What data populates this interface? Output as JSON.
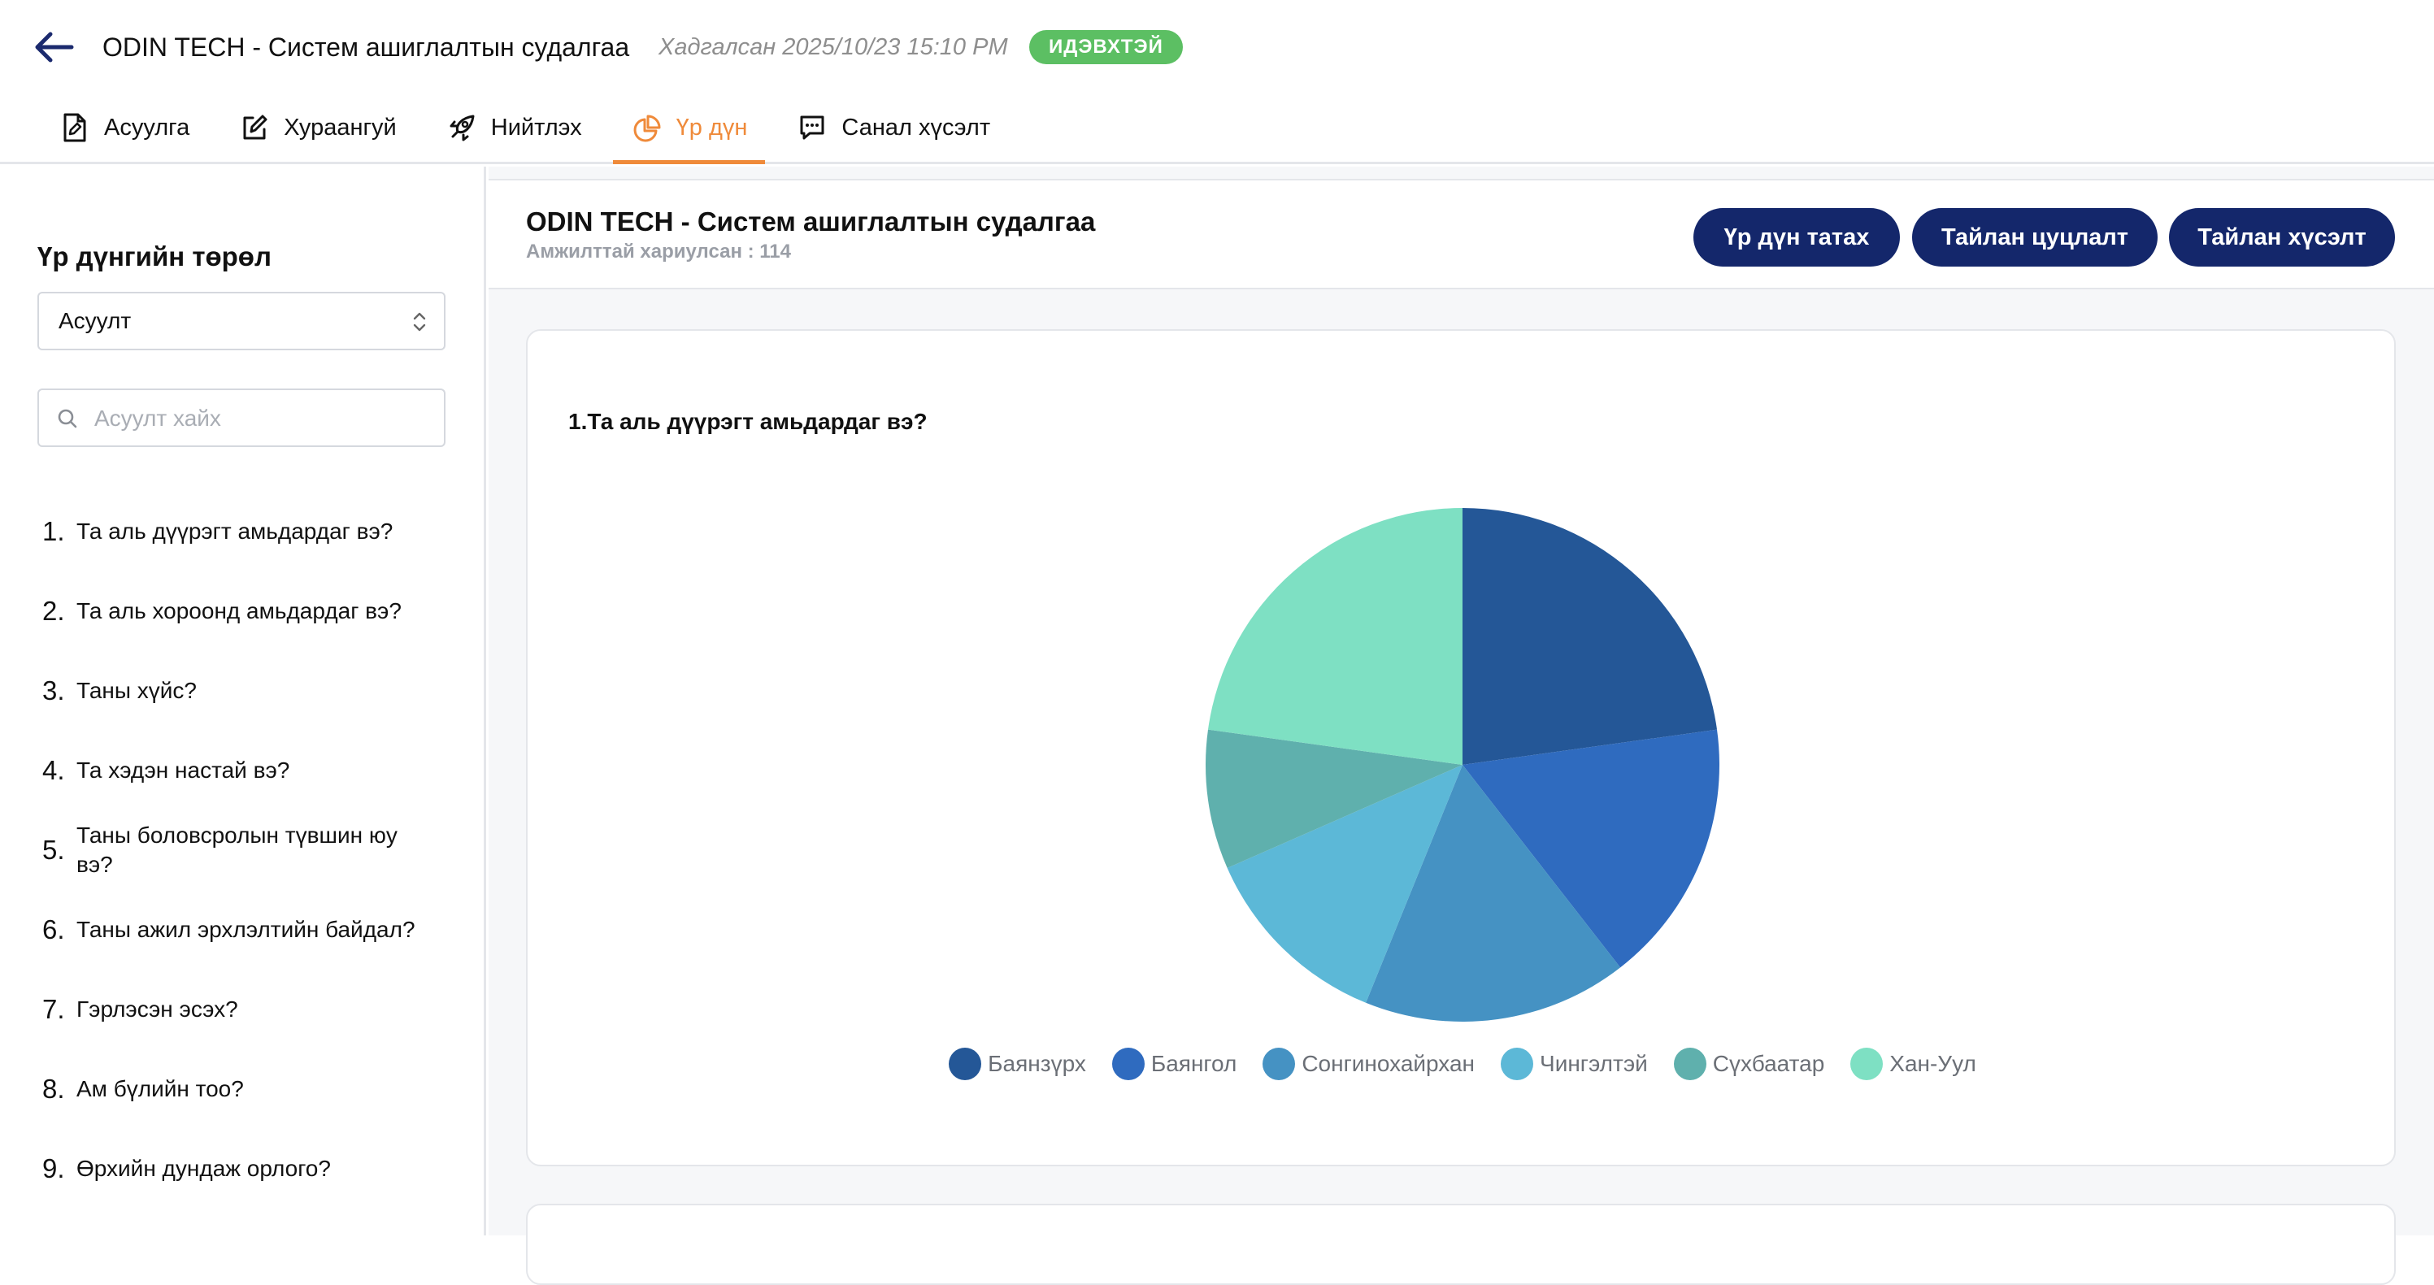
{
  "header": {
    "title": "ODIN TECH - Систем ашиглалтын судалгаа",
    "saved": "Хадгалсан 2025/10/23 15:10 PM",
    "status": "ИДЭВХТЭЙ"
  },
  "tabs": [
    {
      "label": "Асуулга",
      "icon": "document-edit-icon"
    },
    {
      "label": "Хураангуй",
      "icon": "pencil-square-icon"
    },
    {
      "label": "Нийтлэх",
      "icon": "rocket-icon"
    },
    {
      "label": "Үр дүн",
      "icon": "pie-chart-icon",
      "active": true
    },
    {
      "label": "Санал хүсэлт",
      "icon": "chat-icon"
    }
  ],
  "sidebar": {
    "heading": "Үр дүнгийн төрөл",
    "select_value": "Асуулт",
    "search_placeholder": "Асуулт хайх",
    "questions": [
      {
        "num": "1.",
        "text": "Та аль дүүрэгт амьдардаг вэ?"
      },
      {
        "num": "2.",
        "text": "Та аль хороонд амьдардаг вэ?"
      },
      {
        "num": "3.",
        "text": "Таны хүйс?"
      },
      {
        "num": "4.",
        "text": "Та хэдэн настай вэ?"
      },
      {
        "num": "5.",
        "text": "Таны боловсролын түвшин юу вэ?"
      },
      {
        "num": "6.",
        "text": "Таны ажил эрхлэлтийн байдал?"
      },
      {
        "num": "7.",
        "text": "Гэрлэсэн эсэх?"
      },
      {
        "num": "8.",
        "text": "Ам бүлийн тоо?"
      },
      {
        "num": "9.",
        "text": "Өрхийн дундаж орлого?"
      }
    ]
  },
  "main": {
    "title": "ODIN TECH - Систем ашиглалтын судалгаа",
    "answered": "Амжилттай хариулсан : 114",
    "buttons": {
      "download": "Үр дүн татах",
      "cancel_report": "Тайлан цуцлалт",
      "report_request": "Тайлан хүсэлт"
    },
    "question_title": "1.Та аль дүүрэгт амьдардаг вэ?"
  },
  "chart_data": {
    "type": "pie",
    "title": "1.Та аль дүүрэгт амьдардаг вэ?",
    "categories": [
      "Баянзүрх",
      "Баянгол",
      "Сонгинохайрхан",
      "Чингэлтэй",
      "Сүхбаатар",
      "Хан-Уул"
    ],
    "values": [
      26,
      19,
      19,
      14,
      10,
      26
    ],
    "colors": [
      "#245797",
      "#2f6bbf",
      "#4592c3",
      "#5cb8d7",
      "#5fb0ad",
      "#7ee0c3"
    ],
    "legend": "bottom"
  }
}
